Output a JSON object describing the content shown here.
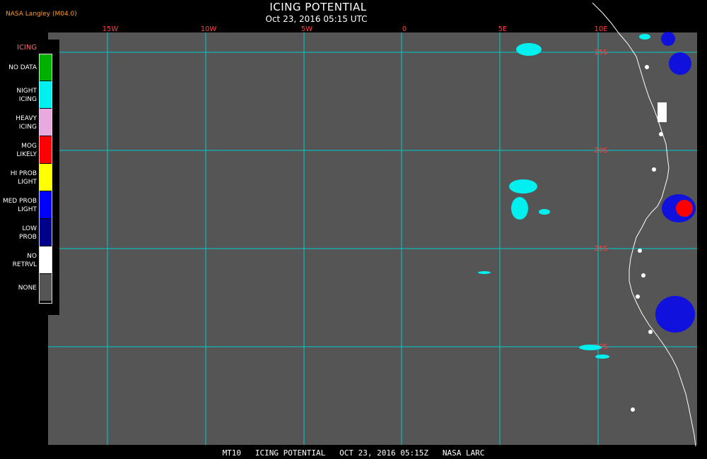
{
  "header": {
    "title": "ICING POTENTIAL",
    "subtitle": "Oct 23, 2016 05:15 UTC",
    "credit": "NASA Langley (M04.0)"
  },
  "footer": {
    "text": "MT10   ICING POTENTIAL   OCT 23, 2016 05:15Z   NASA LARC"
  },
  "legend": {
    "heading": "ICING",
    "items": [
      {
        "label": "NO DATA",
        "color": "#00b000"
      },
      {
        "label": "NIGHT\nICING",
        "color": "#00f0f0"
      },
      {
        "label": "HEAVY\nICING",
        "color": "#e8a8e0"
      },
      {
        "label": "MOG\nLIKELY",
        "color": "#ff0000"
      },
      {
        "label": "HI PROB\nLIGHT",
        "color": "#ffff00"
      },
      {
        "label": "MED PROB\nLIGHT",
        "color": "#0000ff"
      },
      {
        "label": "LOW\nPROB",
        "color": "#00008a"
      },
      {
        "label": "NO\nRETRVL",
        "color": "#ffffff"
      },
      {
        "label": "NONE",
        "color": "#555555"
      }
    ]
  },
  "map": {
    "background": "#555555",
    "grid_color": "#00cccc",
    "coastline_color": "#ffffff",
    "longitude_labels": [
      "15W",
      "10W",
      "5W",
      "0",
      "5E",
      "10E"
    ],
    "latitude_labels": [
      "15S",
      "20S",
      "25S",
      "30S"
    ]
  }
}
